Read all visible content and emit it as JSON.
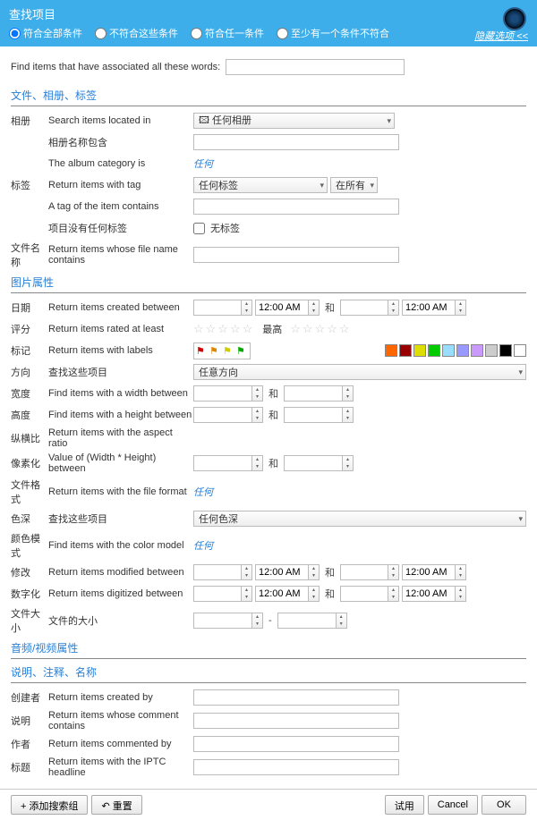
{
  "header": {
    "title": "查找项目",
    "opt1": "符合全部条件",
    "opt2": "不符合这些条件",
    "opt3": "符合任一条件",
    "opt4": "至少有一个条件不符合",
    "hide": "隐藏选项 <<"
  },
  "topquery": {
    "label": "Find items that have associated all these words:"
  },
  "s1": {
    "title": "文件、相册、标签",
    "album": "相册",
    "row1": "Search items located in",
    "anyalbum": "任何相册",
    "row2": "相册名称包含",
    "row3": "The album category is",
    "any": "任何",
    "tags": "标签",
    "row4": "Return items with tag",
    "anytag": "任何标签",
    "inall": "在所有",
    "row5": "A tag of the item contains",
    "row6": "项目没有任何标签",
    "notags": "无标签",
    "filename": "文件名称",
    "row7": "Return items whose file name contains"
  },
  "s2": {
    "title": "图片属性",
    "date": "日期",
    "r1": "Return items created between",
    "time": "12:00 AM",
    "and": "和",
    "rating": "评分",
    "r2": "Return items rated at least",
    "max": "最高",
    "labels": "标记",
    "r3": "Return items with labels",
    "dir": "方向",
    "r4": "查找这些项目",
    "anydir": "任意方向",
    "width": "宽度",
    "r5": "Find items with a width between",
    "height": "高度",
    "r6": "Find items with a height between",
    "aspect": "纵横比",
    "r7": "Return items with the aspect ratio",
    "pixel": "像素化",
    "r8": "Value of (Width * Height) between",
    "format": "文件格式",
    "r9": "Return items with the file format",
    "depth": "色深",
    "r10": "查找这些项目",
    "anydepth": "任何色深",
    "cmodel": "颜色模式",
    "r11": "Find items with the color model",
    "modify": "修改",
    "r12": "Return items modified between",
    "digit": "数字化",
    "r13": "Return items digitized between",
    "fsize": "文件大小",
    "r14": "文件的大小",
    "dash": "-"
  },
  "s3": {
    "title": "音频/视频属性"
  },
  "s4": {
    "title": "说明、注释、名称",
    "creator": "创建者",
    "r1": "Return items created by",
    "caption": "说明",
    "r2": "Return items whose comment contains",
    "author": "作者",
    "r3": "Return items commented by",
    "headline": "标题",
    "r4": "Return items with the IPTC headline"
  },
  "footer": {
    "add": "+ 添加搜索组",
    "reset": "重置",
    "try": "试用",
    "cancel": "Cancel",
    "ok": "OK"
  }
}
